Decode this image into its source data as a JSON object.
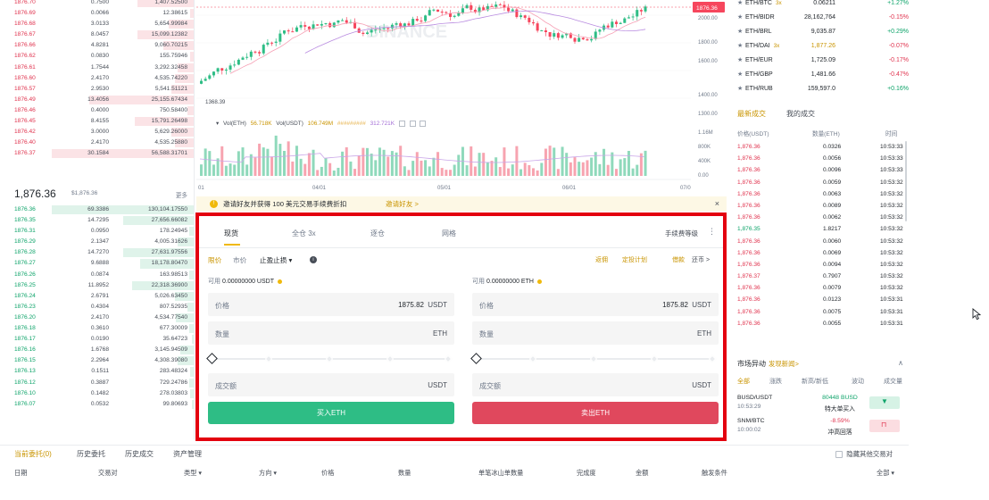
{
  "orderbook": {
    "asks": [
      {
        "price": "1876.70",
        "amount": "0.7500",
        "total": "1,407.52500",
        "depth": 0.4
      },
      {
        "price": "1876.69",
        "amount": "0.0066",
        "total": "12.38615",
        "depth": 0.03
      },
      {
        "price": "1876.68",
        "amount": "3.0133",
        "total": "5,654.99984",
        "depth": 0.18
      },
      {
        "price": "1876.67",
        "amount": "8.0457",
        "total": "15,099.12382",
        "depth": 0.4
      },
      {
        "price": "1876.66",
        "amount": "4.8281",
        "total": "9,060.70215",
        "depth": 0.22
      },
      {
        "price": "1876.62",
        "amount": "0.0830",
        "total": "155.75946",
        "depth": 0.03
      },
      {
        "price": "1876.61",
        "amount": "1.7544",
        "total": "3,292.32458",
        "depth": 0.12
      },
      {
        "price": "1876.60",
        "amount": "2.4170",
        "total": "4,535.74220",
        "depth": 0.14
      },
      {
        "price": "1876.57",
        "amount": "2.9530",
        "total": "5,541.51121",
        "depth": 0.16
      },
      {
        "price": "1876.49",
        "amount": "13.4056",
        "total": "25,155.67434",
        "depth": 0.74
      },
      {
        "price": "1876.46",
        "amount": "0.4000",
        "total": "750.58400",
        "depth": 0.05
      },
      {
        "price": "1876.45",
        "amount": "8.4155",
        "total": "15,791.26498",
        "depth": 0.42
      },
      {
        "price": "1876.42",
        "amount": "3.0000",
        "total": "5,629.26000",
        "depth": 0.16
      },
      {
        "price": "1876.40",
        "amount": "2.4170",
        "total": "4,535.25880",
        "depth": 0.14
      },
      {
        "price": "1876.37",
        "amount": "30.1584",
        "total": "56,588.31701",
        "depth": 1.0
      }
    ],
    "mid_price": "1,876.36",
    "mid_sub": "$1,876.36",
    "more_label": "更多",
    "bids": [
      {
        "price": "1876.36",
        "amount": "69.3386",
        "total": "130,104.17550",
        "depth": 1.0
      },
      {
        "price": "1876.35",
        "amount": "14.7295",
        "total": "27,656.66082",
        "depth": 0.5
      },
      {
        "price": "1876.31",
        "amount": "0.0950",
        "total": "178.24945",
        "depth": 0.04
      },
      {
        "price": "1876.29",
        "amount": "2.1347",
        "total": "4,005.31626",
        "depth": 0.12
      },
      {
        "price": "1876.28",
        "amount": "14.7270",
        "total": "27,631.97556",
        "depth": 0.5
      },
      {
        "price": "1876.27",
        "amount": "9.6888",
        "total": "18,178.80470",
        "depth": 0.38
      },
      {
        "price": "1876.26",
        "amount": "0.0874",
        "total": "163.98513",
        "depth": 0.04
      },
      {
        "price": "1876.25",
        "amount": "11.8952",
        "total": "22,318.36900",
        "depth": 0.44
      },
      {
        "price": "1876.24",
        "amount": "2.6791",
        "total": "5,026.63450",
        "depth": 0.14
      },
      {
        "price": "1876.23",
        "amount": "0.4304",
        "total": "807.52935",
        "depth": 0.05
      },
      {
        "price": "1876.20",
        "amount": "2.4170",
        "total": "4,534.77540",
        "depth": 0.13
      },
      {
        "price": "1876.18",
        "amount": "0.3610",
        "total": "677.30009",
        "depth": 0.04
      },
      {
        "price": "1876.17",
        "amount": "0.0190",
        "total": "35.64723",
        "depth": 0.02
      },
      {
        "price": "1876.16",
        "amount": "1.6768",
        "total": "3,145.94509",
        "depth": 0.1
      },
      {
        "price": "1876.15",
        "amount": "2.2964",
        "total": "4,308.39080",
        "depth": 0.12
      },
      {
        "price": "1876.13",
        "amount": "0.1511",
        "total": "283.48324",
        "depth": 0.03
      },
      {
        "price": "1876.12",
        "amount": "0.3887",
        "total": "729.24786",
        "depth": 0.04
      },
      {
        "price": "1876.10",
        "amount": "0.1482",
        "total": "278.03803",
        "depth": 0.03
      },
      {
        "price": "1876.07",
        "amount": "0.0532",
        "total": "99.80693",
        "depth": 0.02
      }
    ]
  },
  "chart": {
    "price_label": "1876.36",
    "low_label": "1368.39",
    "watermark": "BINANCE",
    "price_ticks": [
      "2000.00",
      "1800.00",
      "1600.00",
      "1400.00",
      "1300.00"
    ],
    "volume_ticks": [
      "1.16M",
      "800K",
      "400K",
      "0.00"
    ],
    "date_ticks": [
      "01",
      "04/01",
      "05/01",
      "06/01",
      "07/0"
    ],
    "vol_legend": {
      "title": "Vol(ETH)",
      "eth": "56.718K",
      "usdt_label": "Vol(USDT)",
      "usdt": "106.749M",
      "ma1": "#########",
      "ma2": "312.721K"
    },
    "colors": {
      "up": "#2ebd85",
      "down": "#f6465d",
      "ma1": "#e7b24a",
      "ma2": "#a46fd6"
    }
  },
  "announcement": {
    "text": "邀请好友并获得 100 美元交易手续费折扣",
    "link": "邀请好友 >",
    "close": "×"
  },
  "trade": {
    "tabs": [
      "现货",
      "全仓 3x",
      "逐仓",
      "网格"
    ],
    "rebate": "手续费等级",
    "more": "⋮",
    "order_types": [
      "限价",
      "市价",
      "止盈止损 ▾"
    ],
    "order_tools": [
      "返佣",
      "定投计划",
      "借款",
      "还币 >"
    ],
    "buy": {
      "avail_label": "可用",
      "avail_value": "0.00000000 USDT",
      "price_label": "价格",
      "price_value": "1875.82",
      "price_unit": "USDT",
      "amount_label": "数量",
      "amount_unit": "ETH",
      "total_label": "成交额",
      "total_unit": "USDT",
      "button": "买入ETH"
    },
    "sell": {
      "avail_label": "可用",
      "avail_value": "0.00000000 ETH",
      "price_label": "价格",
      "price_value": "1875.82",
      "price_unit": "USDT",
      "amount_label": "数量",
      "amount_unit": "ETH",
      "total_label": "成交额",
      "total_unit": "USDT",
      "button": "卖出ETH"
    }
  },
  "market": [
    {
      "pair": "ETH/BTC",
      "lev": "3x",
      "price": "0.06211",
      "change": "+1.27%",
      "dir": "up"
    },
    {
      "pair": "ETH/BIDR",
      "lev": "",
      "price": "28,162,764",
      "change": "-0.15%",
      "dir": "down"
    },
    {
      "pair": "ETH/BRL",
      "lev": "",
      "price": "9,035.87",
      "change": "+0.29%",
      "dir": "up"
    },
    {
      "pair": "ETH/DAI",
      "lev": "3x",
      "price": "1,877.26",
      "change": "-0.07%",
      "dir": "down"
    },
    {
      "pair": "ETH/EUR",
      "lev": "",
      "price": "1,725.09",
      "change": "-0.17%",
      "dir": "down"
    },
    {
      "pair": "ETH/GBP",
      "lev": "",
      "price": "1,481.66",
      "change": "-0.47%",
      "dir": "down"
    },
    {
      "pair": "ETH/RUB",
      "lev": "",
      "price": "159,597.0",
      "change": "+0.16%",
      "dir": "up"
    }
  ],
  "trades": {
    "tabs": [
      "最新成交",
      "我的成交"
    ],
    "headers": [
      "价格(USDT)",
      "数量(ETH)",
      "时间"
    ],
    "rows": [
      {
        "price": "1,876.36",
        "qty": "0.0326",
        "time": "10:53:33",
        "dir": "down"
      },
      {
        "price": "1,876.36",
        "qty": "0.0056",
        "time": "10:53:33",
        "dir": "down"
      },
      {
        "price": "1,876.36",
        "qty": "0.0096",
        "time": "10:53:33",
        "dir": "down"
      },
      {
        "price": "1,876.36",
        "qty": "0.0059",
        "time": "10:53:32",
        "dir": "down"
      },
      {
        "price": "1,876.36",
        "qty": "0.0063",
        "time": "10:53:32",
        "dir": "down"
      },
      {
        "price": "1,876.36",
        "qty": "0.0089",
        "time": "10:53:32",
        "dir": "down"
      },
      {
        "price": "1,876.36",
        "qty": "0.0062",
        "time": "10:53:32",
        "dir": "down"
      },
      {
        "price": "1,876.35",
        "qty": "1.8217",
        "time": "10:53:32",
        "dir": "up"
      },
      {
        "price": "1,876.36",
        "qty": "0.0060",
        "time": "10:53:32",
        "dir": "down"
      },
      {
        "price": "1,876.36",
        "qty": "0.0069",
        "time": "10:53:32",
        "dir": "down"
      },
      {
        "price": "1,876.36",
        "qty": "0.0094",
        "time": "10:53:32",
        "dir": "down"
      },
      {
        "price": "1,876.37",
        "qty": "0.7907",
        "time": "10:53:32",
        "dir": "down"
      },
      {
        "price": "1,876.36",
        "qty": "0.0079",
        "time": "10:53:32",
        "dir": "down"
      },
      {
        "price": "1,876.36",
        "qty": "0.0123",
        "time": "10:53:31",
        "dir": "down"
      },
      {
        "price": "1,876.36",
        "qty": "0.0075",
        "time": "10:53:31",
        "dir": "down"
      },
      {
        "price": "1,876.36",
        "qty": "0.0055",
        "time": "10:53:31",
        "dir": "down"
      }
    ]
  },
  "movers": {
    "title": "市场异动",
    "link": "发现新闻>",
    "collapse": "∧",
    "tabs": [
      "全部",
      "涨跌",
      "新高/新低",
      "波动",
      "成交量"
    ],
    "rows": [
      {
        "pair": "BUSD/USDT",
        "time": "10:53:29",
        "value": "80448 BUSD",
        "desc": "特大单买入",
        "dir": "up"
      },
      {
        "pair": "SNM/BTC",
        "time": "10:00:02",
        "value": "-8.59%",
        "desc": "冲高回落",
        "dir": "down"
      }
    ]
  },
  "orders": {
    "tabs": [
      "当前委托(0)",
      "历史委托",
      "历史成交",
      "资产管理"
    ],
    "hide_label": "隐藏其他交易对",
    "headers": [
      "日期",
      "交易对",
      "类型 ▾",
      "方向 ▾",
      "价格",
      "数量",
      "单笔冰山单数量",
      "完成度",
      "金额",
      "触发条件",
      "全部 ▾"
    ]
  }
}
